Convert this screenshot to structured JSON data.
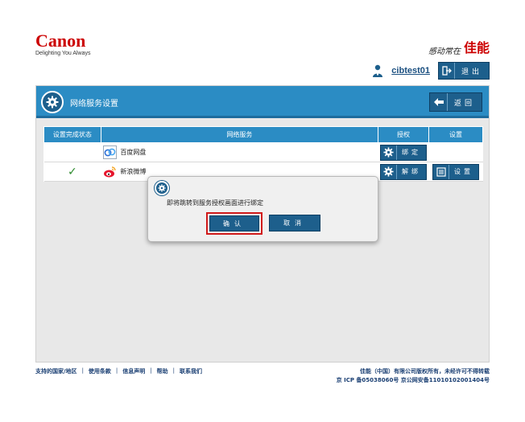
{
  "header": {
    "logo_text": "Canon",
    "logo_tagline": "Delighting You Always",
    "brand_slogan": "感动常在",
    "brand_name": "佳能",
    "username": "cibtest01",
    "logout_label": "退出"
  },
  "panel": {
    "title": "网络服务设置",
    "back_label": "返回",
    "columns": [
      "设置完成状态",
      "网络服务",
      "授权",
      "设置"
    ],
    "rows": [
      {
        "status": "",
        "service": "百度网盘",
        "service_icon": "baidu-netdisk-icon",
        "auth_label": "绑定",
        "setting_label": ""
      },
      {
        "status": "✓",
        "service": "新浪微博",
        "service_icon": "sina-weibo-icon",
        "auth_label": "解绑",
        "setting_label": "设置"
      }
    ]
  },
  "dialog": {
    "message": "即将跳转到服务授权画面进行绑定",
    "confirm_label": "确认",
    "cancel_label": "取消"
  },
  "footer": {
    "links": [
      "支持的国家/地区",
      "使用条款",
      "信息声明",
      "帮助",
      "联系我们"
    ],
    "copyright": "佳能（中国）有限公司版权所有，未经许可不得转载",
    "icp": "京 ICP 备05038060号 京公网安备11010102001404号"
  },
  "colors": {
    "accent": "#2b8cc4",
    "button": "#1d5f8c",
    "brand_red": "#cc0000",
    "highlight_border": "#d11a1a"
  }
}
